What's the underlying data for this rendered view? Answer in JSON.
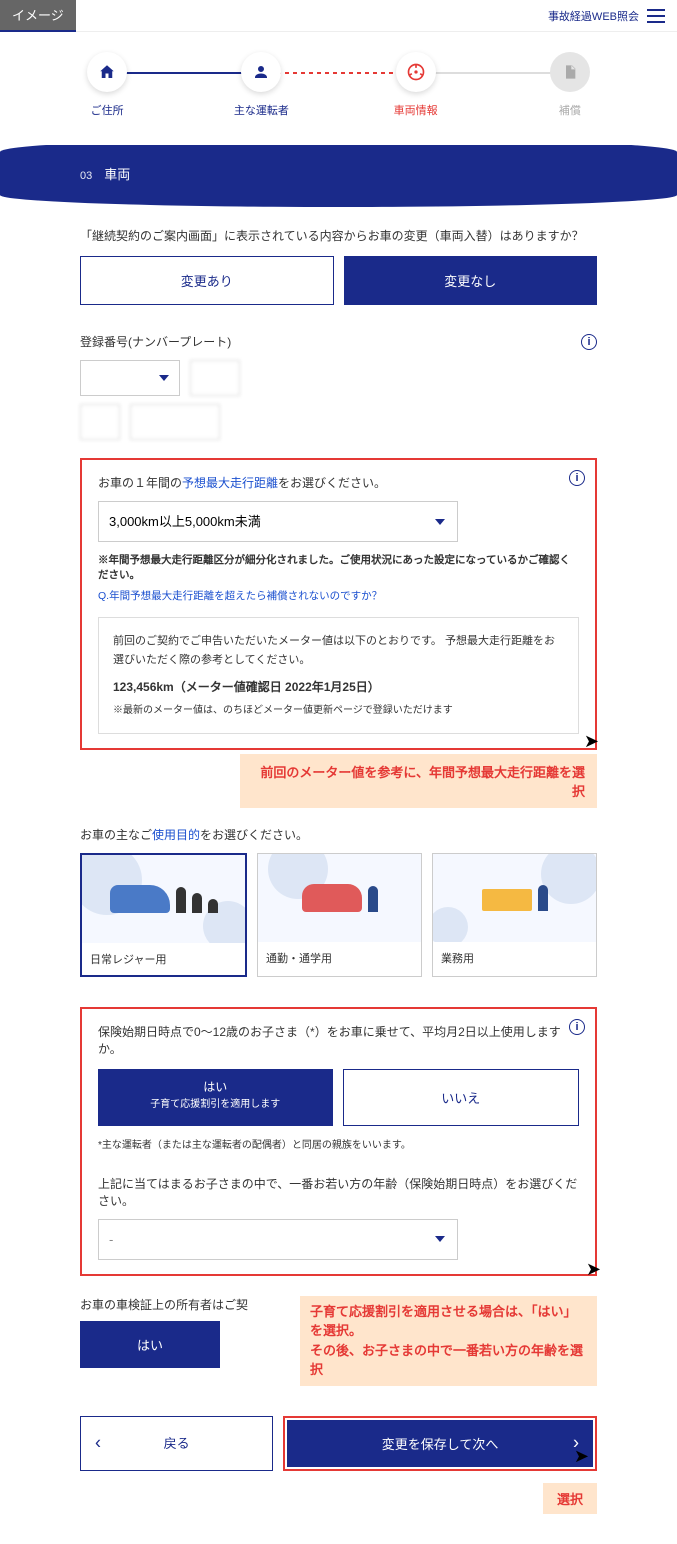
{
  "topbar": {
    "badge": "イメージ",
    "link": "事故経過WEB照会"
  },
  "stepper": {
    "s1": "ご住所",
    "s2": "主な運転者",
    "s3": "車両情報",
    "s4": "補償"
  },
  "section": {
    "num": "03",
    "title": "車両"
  },
  "change": {
    "question": "「継続契約のご案内画面」に表示されている内容からお車の変更（車両入替）はありますか？",
    "yes": "変更あり",
    "no": "変更なし"
  },
  "plate": {
    "label": "登録番号(ナンバープレート)"
  },
  "mileage": {
    "q_pre": "お車の１年間の",
    "q_link": "予想最大走行距離",
    "q_post": "をお選びください。",
    "selected": "3,000km以上5,000km未満",
    "note": "※年間予想最大走行距離区分が細分化されました。ご使用状況にあった設定になっているかご確認ください。",
    "faq_pre": "Q.",
    "faq": "年間予想最大走行距離を超えたら補償されないのですか？",
    "meter_intro": "前回のご契約でご申告いただいたメーター値は以下のとおりです。 予想最大走行距離をお選びいただく際の参考としてください。",
    "meter_value": "123,456km（メーター値確認日 2022年1月25日）",
    "meter_note": "※最新のメーター値は、のちほどメーター値更新ページで登録いただけます",
    "callout": "前回のメーター値を参考に、年間予想最大走行距離を選択"
  },
  "purpose": {
    "q_pre": "お車の主なご",
    "q_link": "使用目的",
    "q_post": "をお選びください。",
    "opt1": "日常レジャー用",
    "opt2": "通勤・通学用",
    "opt3": "業務用"
  },
  "child": {
    "question": "保険始期日時点で0～12歳のお子さま（*）をお車に乗せて、平均月2日以上使用しますか。",
    "yes": "はい",
    "yes_sub": "子育て応援割引を適用します",
    "no": "いいえ",
    "note": "*主な運転者（または主な運転者の配偶者）と同居の親族をいいます。",
    "age_q": "上記に当てはまるお子さまの中で、一番お若い方の年齢（保険始期日時点）をお選びください。",
    "age_selected": "-",
    "callout_l1": "子育て応援割引を適用させる場合は、「はい」を選択。",
    "callout_l2": "その後、お子さまの中で一番若い方の年齢を選択"
  },
  "owner": {
    "q": "お車の車検証上の所有者はご契",
    "yes": "はい"
  },
  "footer": {
    "back": "戻る",
    "next": "変更を保存して次へ",
    "select": "選択"
  }
}
